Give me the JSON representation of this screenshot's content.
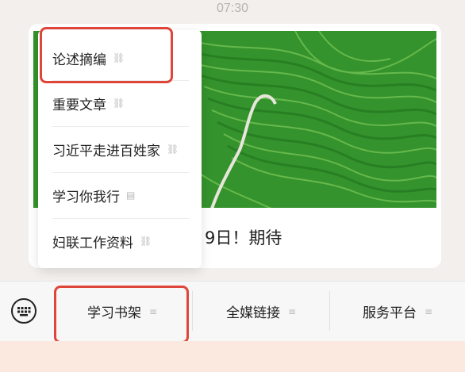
{
  "status_bar": {
    "time": "07:30"
  },
  "article": {
    "headline": "9日！期待"
  },
  "popup_menu": {
    "items": [
      {
        "label": "论述摘编",
        "icon": "link-icon",
        "glyph": "⛓"
      },
      {
        "label": "重要文章",
        "icon": "link-icon",
        "glyph": "⛓"
      },
      {
        "label": "习近平走进百姓家",
        "icon": "link-icon",
        "glyph": "⛓"
      },
      {
        "label": "学习你我行",
        "icon": "document-icon",
        "glyph": "▤"
      },
      {
        "label": "妇联工作资料",
        "icon": "link-icon",
        "glyph": "⛓"
      }
    ]
  },
  "bottom_bar": {
    "keyboard_icon": "keyboard-icon",
    "tabs": [
      {
        "label": "学习书架",
        "icon": "menu-icon",
        "glyph": "≡"
      },
      {
        "label": "全媒链接",
        "icon": "menu-icon",
        "glyph": "≡"
      },
      {
        "label": "服务平台",
        "icon": "menu-icon",
        "glyph": "≡"
      }
    ]
  },
  "colors": {
    "highlight": "#e0453a",
    "background": "#f3efec",
    "footer": "#fbe9df",
    "terrace_green": "#2f8a2a"
  }
}
